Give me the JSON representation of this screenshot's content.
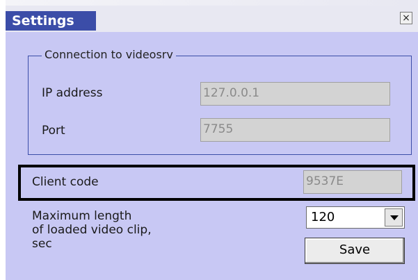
{
  "window": {
    "title": "Settings",
    "close_glyph": "×"
  },
  "connection": {
    "group_title": "Connection to videosrv",
    "ip_label": "IP address",
    "ip_value": "127.0.0.1",
    "port_label": "Port",
    "port_value": "7755"
  },
  "client": {
    "label": "Client code",
    "value": "9537E"
  },
  "clip": {
    "label_line1": "Maximum length",
    "label_line2": "of loaded video clip,",
    "label_line3": "sec",
    "selected_value": "120"
  },
  "buttons": {
    "save_label": "Save"
  },
  "colors": {
    "dialog_background": "#c8c8f4",
    "title_background": "#3b4da8",
    "group_border": "#3b4da8",
    "highlight_border": "#000000"
  },
  "icons": {
    "close": "close-icon",
    "dropdown": "chevron-down-icon"
  }
}
